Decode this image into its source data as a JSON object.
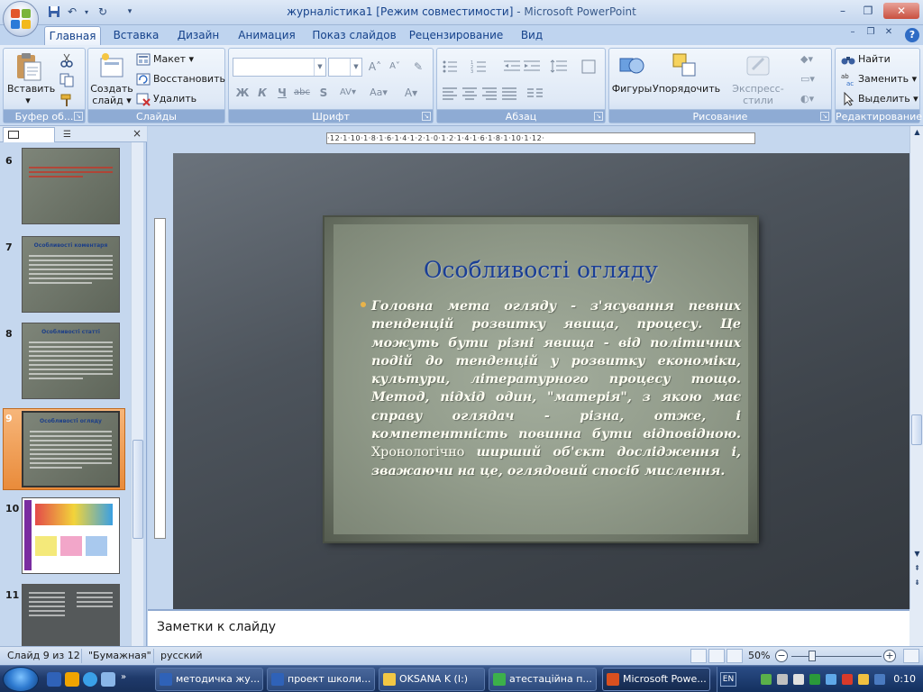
{
  "window": {
    "title": "журналістика1 [Режим совместимости]",
    "app": " - Microsoft PowerPoint",
    "min": "–",
    "max": "❐",
    "close": "✕",
    "inner_min": "–",
    "inner_restore": "❐",
    "inner_close": "✕"
  },
  "quick_access": {
    "save_icon": "save-icon",
    "undo_icon": "undo-icon",
    "redo_icon": "redo-icon"
  },
  "tabs": [
    "Главная",
    "Вставка",
    "Дизайн",
    "Анимация",
    "Показ слайдов",
    "Рецензирование",
    "Вид"
  ],
  "help": "?",
  "ribbon": {
    "clipboard": {
      "label": "Буфер об...",
      "paste": "Вставить",
      "paste_arrow": "▾"
    },
    "slides": {
      "label": "Слайды",
      "create": "Создать",
      "create2": "слайд ▾",
      "layout": "Макет ▾",
      "reset": "Восстановить",
      "delete": "Удалить"
    },
    "font": {
      "label": "Шрифт",
      "bold": "Ж",
      "italic": "К",
      "underline": "Ч",
      "strike": "abc",
      "shadow": "S",
      "spacing": "AV▾",
      "case": "Aa▾",
      "color": "A▾",
      "grow": "A˄",
      "shrink": "A˅"
    },
    "paragraph": {
      "label": "Абзац"
    },
    "drawing": {
      "label": "Рисование",
      "shapes": "Фигуры",
      "arrange": "Упорядочить",
      "quick_styles": "Экспресс-стили"
    },
    "editing": {
      "label": "Редактирование",
      "find": "Найти",
      "replace": "Заменить ▾",
      "select": "Выделить ▾"
    }
  },
  "slides_pane": {
    "close": "×",
    "thumbnails": [
      {
        "num": "6"
      },
      {
        "num": "7",
        "title": "Особливості коментаря"
      },
      {
        "num": "8",
        "title": "Особливості статті"
      },
      {
        "num": "9",
        "title": "Особливості огляду"
      },
      {
        "num": "10"
      },
      {
        "num": "11"
      }
    ]
  },
  "ruler": {
    "h": "·12·1·10·1·8·1·6·1·4·1·2·1·0·1·2·1·4·1·6·1·8·1·10·1·12·"
  },
  "slide": {
    "title": "Особливості огляду",
    "body_a": "Головна мета огляду - з'ясування певних тенденцій розвитку явища, процесу. Це можуть бути різні явища - від політичних подій до тенденцій у розвитку економіки, культури, літературного процесу тощо. Метод, підхід один, \"матерія\", з якою має справу оглядач - різна, отже, і компетентність повинна бути відповідною. ",
    "body_b": "Хронологічно",
    "body_c": " ширший об'єкт дослідження і, зважаючи на це, оглядовий спосіб мислення."
  },
  "notes": {
    "placeholder": "Заметки к слайду"
  },
  "status": {
    "slide": "Слайд 9 из 12",
    "theme": "\"Бумажная\"",
    "language": "русский",
    "zoom": "50%",
    "zoom_level": 50
  },
  "taskbar": {
    "tasks": [
      "методичка жу...",
      "проект школи...",
      "OKSANA K (I:)",
      "атестаційна п...",
      "Microsoft Powe..."
    ],
    "lang": "EN",
    "clock": "0:10"
  },
  "colors": {
    "accent": "#15428b",
    "title_blue": "#1a3e96",
    "selected_slide": "#e98b3a"
  }
}
